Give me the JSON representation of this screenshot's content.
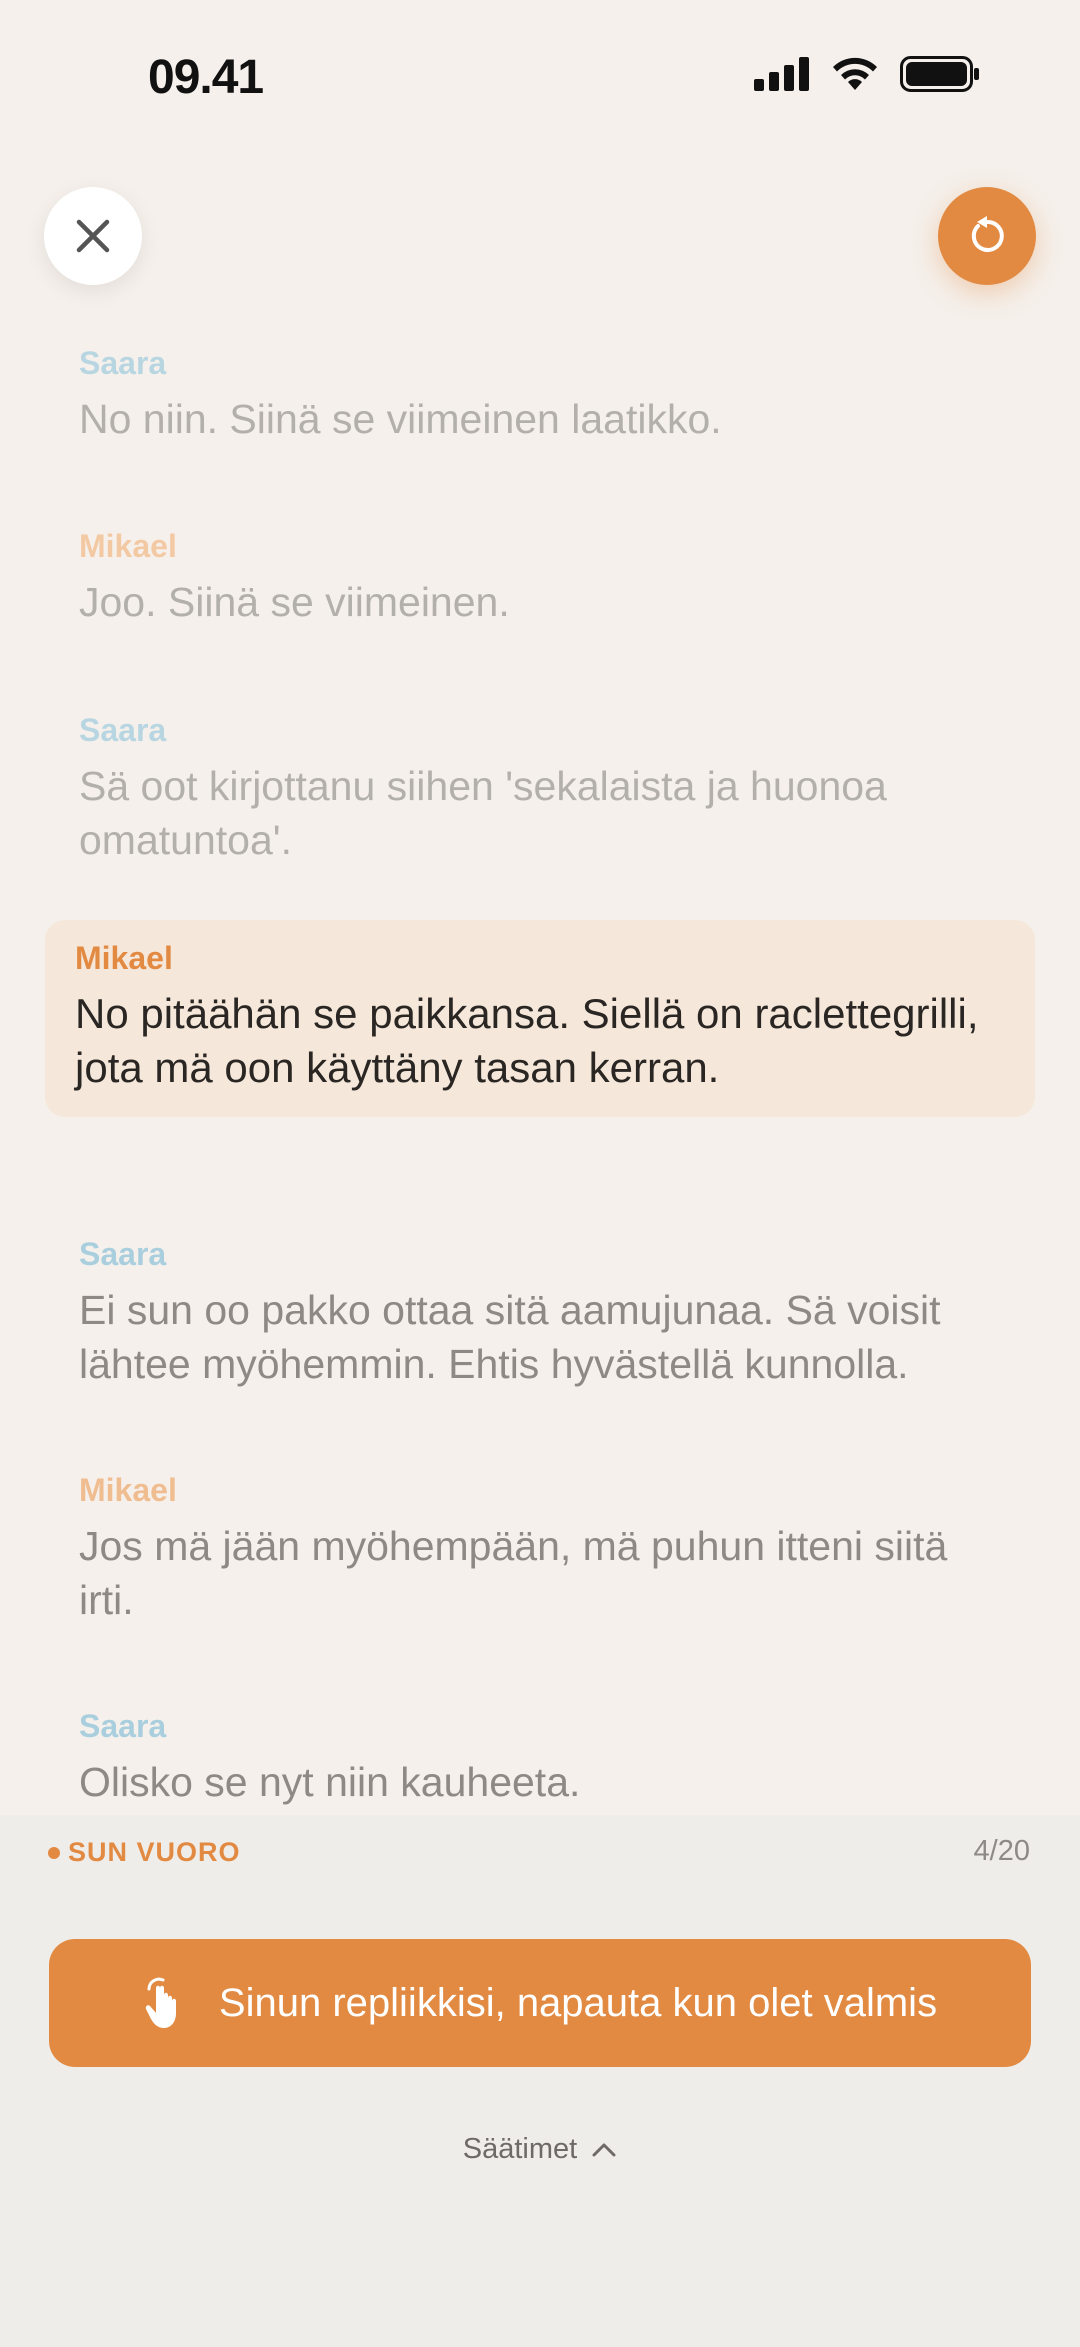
{
  "status_bar": {
    "time": "09.41"
  },
  "icons": {
    "close": "close-icon",
    "restart": "restart-icon",
    "tap": "hand-tap-icon",
    "chevron": "chevron-up-icon"
  },
  "colors": {
    "accent": "#E28A42",
    "background": "#F5F0EB",
    "highlight": "#F5E8DA"
  },
  "script": {
    "lines": [
      {
        "speaker": "Saara",
        "text": "No niin. Siinä se viimeinen laatikko.",
        "state": "past"
      },
      {
        "speaker": "Mikael",
        "text": "Joo. Siinä se viimeinen.",
        "state": "past"
      },
      {
        "speaker": "Saara",
        "text": "Sä oot kirjottanu siihen 'sekalaista ja huonoa omatuntoa'.",
        "state": "past"
      },
      {
        "speaker": "Mikael",
        "text": "No pitäähän se paikkansa. Siellä on raclettegrilli, jota mä oon käyttäny tasan kerran.",
        "state": "current"
      },
      {
        "speaker": "Saara",
        "text": "Ei sun oo pakko ottaa sitä aamujunaa. Sä voisit lähtee myöhemmin. Ehtis hyvästellä kunnolla.",
        "state": "next"
      },
      {
        "speaker": "Mikael",
        "text": "Jos mä jään myöhempään, mä puhun itteni siitä irti.",
        "state": "next"
      },
      {
        "speaker": "Saara",
        "text": "Olisko se nyt niin kauheeta.",
        "state": "next"
      }
    ]
  },
  "bottom": {
    "turn_label": "SUN VUORO",
    "progress": "4/20",
    "action_label": "Sinun repliikkisi, napauta kun olet valmis",
    "controls_label": "Säätimet"
  }
}
